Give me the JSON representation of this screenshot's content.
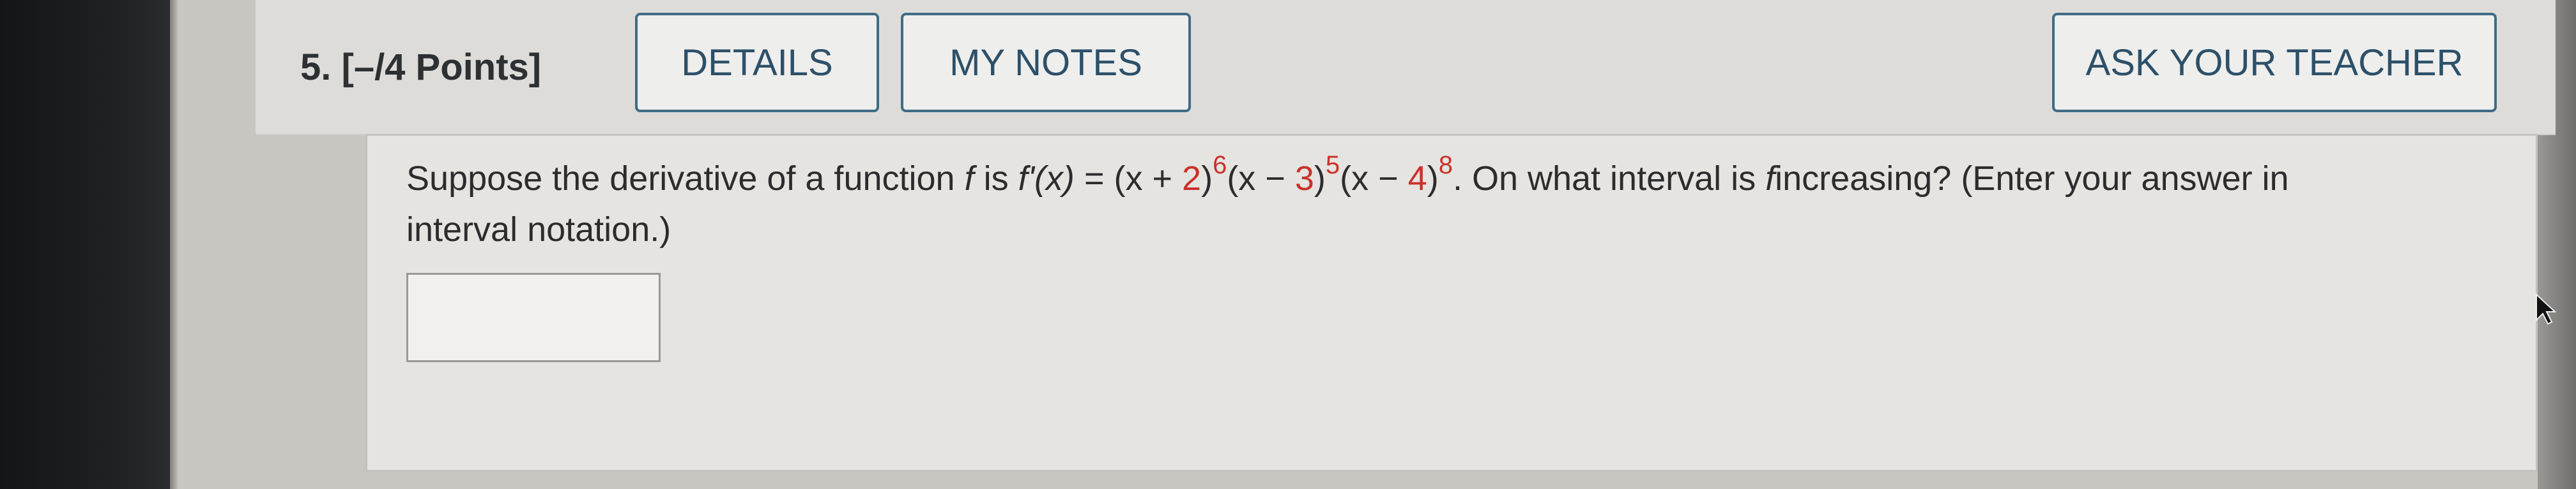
{
  "header": {
    "question_number": "5.",
    "points": "[–/4 Points]",
    "details_label": "DETAILS",
    "my_notes_label": "MY NOTES",
    "ask_teacher_label": "ASK YOUR TEACHER"
  },
  "question": {
    "intro": "Suppose the derivative of a function",
    "f": "f",
    "is": "is",
    "fprime": "f'(x)",
    "equals": "=",
    "term1": "(x + ",
    "term1_num": "2",
    "term1_close": ")",
    "exp1": "6",
    "term2": "(x − ",
    "term2_num": "3",
    "term2_close": ")",
    "exp2": "5",
    "term3": "(x − ",
    "term3_num": "4",
    "term3_close": ")",
    "exp3": "8",
    "after_formula": ". On what interval is",
    "f2": "f",
    "tail": "increasing? (Enter your answer in",
    "line2": "interval notation.)"
  },
  "answer": {
    "value": ""
  },
  "colors": {
    "accent": "#3f6c86",
    "highlight": "#c8322a"
  }
}
